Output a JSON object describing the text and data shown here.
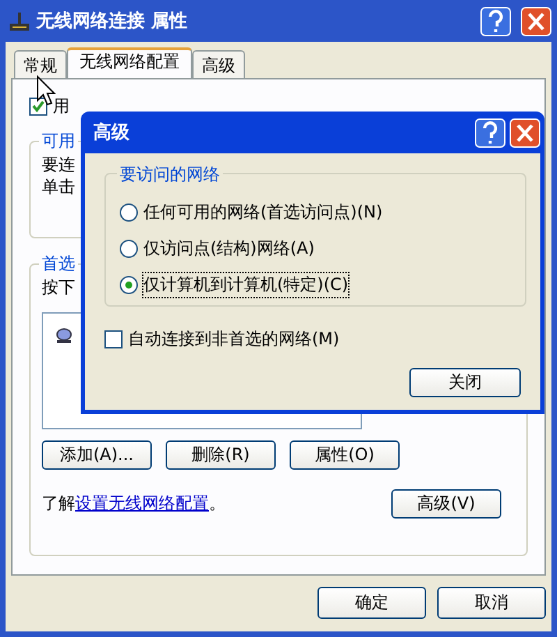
{
  "window": {
    "title": "无线网络连接 属性"
  },
  "tabs": [
    {
      "label": "常规",
      "selected": false
    },
    {
      "label": "无线网络配置",
      "selected": true
    },
    {
      "label": "高级",
      "selected": false
    }
  ],
  "use_windows": {
    "label": "用",
    "checked": true
  },
  "available_group": {
    "label": "可用",
    "lines": [
      "要连",
      "单击"
    ]
  },
  "preferred_group": {
    "label": "首选",
    "line": "按下"
  },
  "list_buttons": [
    "添加(A)...",
    "删除(R)",
    "属性(O)"
  ],
  "learn": {
    "prefix": "了解",
    "link": "设置无线网络配置",
    "suffix": "。"
  },
  "advanced_button": "高级(V)",
  "footer_buttons": [
    "确定",
    "取消"
  ],
  "dialog": {
    "title": "高级",
    "group_label": "要访问的网络",
    "options": [
      {
        "label": "任何可用的网络(首选访问点)(N)",
        "selected": false
      },
      {
        "label": "仅访问点(结构)网络(A)",
        "selected": false
      },
      {
        "label": "仅计算机到计算机(特定)(C)",
        "selected": true
      }
    ],
    "auto_connect": {
      "label": "自动连接到非首选的网络(M)",
      "checked": false
    },
    "close_button": "关闭"
  }
}
